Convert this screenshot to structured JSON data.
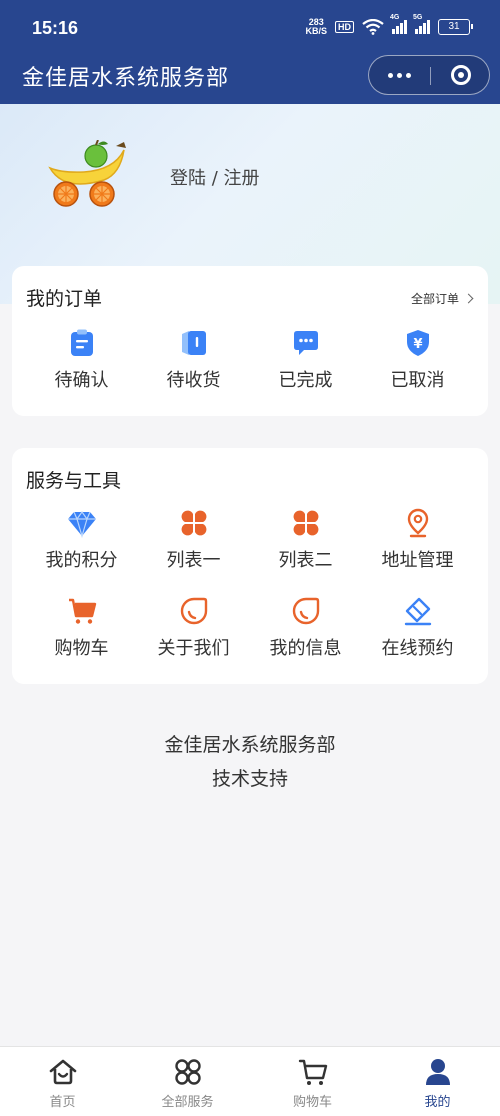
{
  "status_bar": {
    "time": "15:16",
    "net_speed_top": "283",
    "net_speed_bottom": "KB/S",
    "hd": "HD",
    "sim1": "4G",
    "sim2": "5G",
    "battery": "31"
  },
  "header": {
    "title": "金佳居水系统服务部"
  },
  "profile": {
    "login_label": "登陆 / 注册"
  },
  "orders": {
    "title": "我的订单",
    "all_link": "全部订单",
    "items": [
      {
        "label": "待确认",
        "icon": "clipboard-icon"
      },
      {
        "label": "待收货",
        "icon": "package-icon"
      },
      {
        "label": "已完成",
        "icon": "chat-bubble-icon"
      },
      {
        "label": "已取消",
        "icon": "yen-shield-icon"
      }
    ]
  },
  "tools": {
    "title": "服务与工具",
    "items": [
      {
        "label": "我的积分",
        "icon": "diamond-icon"
      },
      {
        "label": "列表一",
        "icon": "four-petal-icon"
      },
      {
        "label": "列表二",
        "icon": "four-petal-icon"
      },
      {
        "label": "地址管理",
        "icon": "location-pin-icon"
      },
      {
        "label": "购物车",
        "icon": "cart-icon"
      },
      {
        "label": "关于我们",
        "icon": "drop-icon"
      },
      {
        "label": "我的信息",
        "icon": "drop-icon"
      },
      {
        "label": "在线预约",
        "icon": "ticket-icon"
      }
    ]
  },
  "footer": {
    "line1": "金佳居水系统服务部",
    "line2": "技术支持"
  },
  "tabbar": {
    "items": [
      {
        "label": "首页",
        "icon": "home-icon"
      },
      {
        "label": "全部服务",
        "icon": "grid-icon"
      },
      {
        "label": "购物车",
        "icon": "cart-icon"
      },
      {
        "label": "我的",
        "icon": "user-icon"
      }
    ],
    "active": "我的"
  },
  "colors": {
    "header_bg": "#28468f",
    "icon_blue": "#3b82f6",
    "icon_orange": "#e8632b",
    "tab_active": "#28468f"
  }
}
